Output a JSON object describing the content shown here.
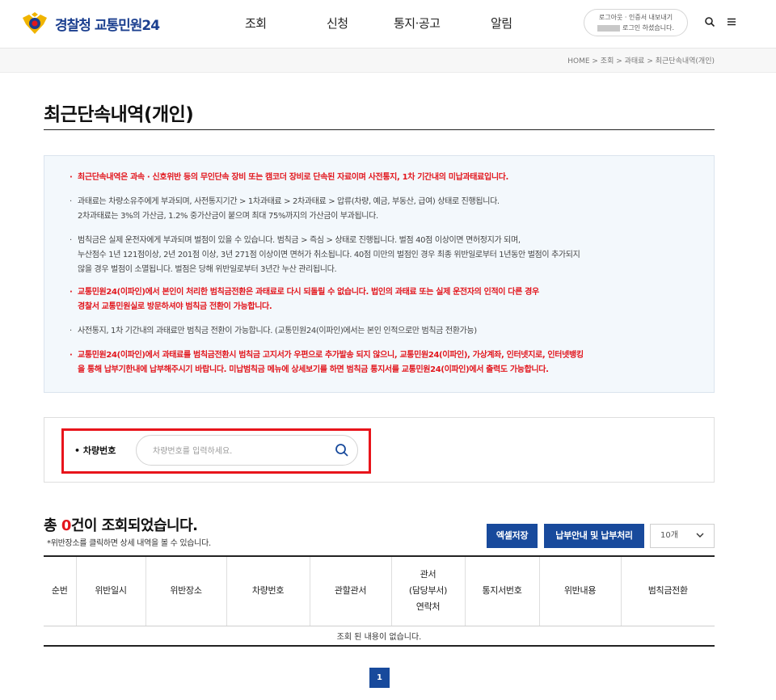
{
  "header": {
    "logo_text": "경찰청 교통민원24",
    "nav": [
      "조회",
      "신청",
      "통지·공고",
      "알림"
    ],
    "login_line1": "로그아웃 · 인증서 내보내기",
    "login_line2": "로그인 하셨습니다."
  },
  "breadcrumb": "HOME > 조회 > 과태료 > 최근단속내역(개인)",
  "page_title": "최근단속내역(개인)",
  "notices": [
    {
      "color": "red",
      "lines": [
        "최근단속내역은 과속 · 신호위반 등의 무인단속 장비 또는 캠코더 장비로 단속된 자료이며 사전통지, 1차 기간내의 미납과태료입니다."
      ]
    },
    {
      "color": "gray",
      "lines": [
        "과태료는 차량소유주에게 부과되며, 사전통지기간 > 1차과태료 > 2차과태료 > 압류(차량, 예금, 부동산, 급여) 상태로 진행됩니다.",
        "2차과태료는 3%의 가산금, 1.2% 중가산금이 붙으며 최대 75%까지의 가산금이 부과됩니다."
      ]
    },
    {
      "color": "gray",
      "lines": [
        "범칙금은 실제 운전자에게 부과되며 벌점이 있을 수 있습니다. 범칙금 > 즉심 > 상태로 진행됩니다. 벌점 40점 이상이면 면허정지가 되며,",
        "누산점수 1년 121점이상, 2년 201점 이상, 3년 271점 이상이면 면허가 취소됩니다. 40점 미만의 벌점인 경우 최종 위반일로부터 1년동안 벌점이 추가되지",
        "않을 경우 벌점이 소멸됩니다. 벌점은 당해 위반일로부터 3년간 누산 관리됩니다."
      ]
    },
    {
      "color": "red",
      "lines": [
        "교통민원24(이파인)에서 본인이 처리한 범칙금전환은 과태료로 다시 되돌릴 수 없습니다. 법인의 과태료 또는 실제 운전자의 인적이 다른 경우",
        "경찰서 교통민원실로 방문하셔야 범칙금 전환이 가능합니다."
      ]
    },
    {
      "color": "gray",
      "lines": [
        "사전통지, 1차 기간내의 과태료만 범칙금 전환이 가능합니다. (교통민원24(이파인)에서는 본인 인적으로만 범칙금 전환가능)"
      ]
    },
    {
      "color": "red",
      "lines": [
        "교통민원24(이파인)에서 과태료를 범칙금전환시 범칙금 고지서가 우편으로 추가발송 되지 않으니, 교통민원24(이파인), 가상계좌, 인터넷지로, 인터넷뱅킹",
        "을 통해 납부기한내에 납부해주시기 바랍니다. 미납범칙금 메뉴에 상세보기를 하면 범칙금 통지서를 교통민원24(이파인)에서 출력도 가능합니다."
      ]
    }
  ],
  "search": {
    "label": "• 차량번호",
    "placeholder": "차량번호를 입력하세요.",
    "value": ""
  },
  "results": {
    "total_prefix": "총 ",
    "count": "0",
    "total_suffix": "건이 조회되었습니다.",
    "hint": "*위반장소를 클릭하면 상세 내역을 볼 수 있습니다.",
    "excel_button": "엑셀저장",
    "pay_button": "납부안내 및 납부처리",
    "page_size": "10개"
  },
  "table": {
    "columns": [
      "순번",
      "위반일시",
      "위반장소",
      "차량번호",
      "관할관서",
      "관서\n(담당부서)\n연락처",
      "통지서번호",
      "위반내용",
      "범칙금전환"
    ],
    "empty_message": "조회 된 내용이 없습니다."
  },
  "pagination": {
    "current": "1"
  },
  "colors": {
    "brand": "#184a9c",
    "alert": "#e2161d",
    "highlight": "#e8141b"
  },
  "icons": [
    "police-emblem-icon",
    "search-icon",
    "menu-icon",
    "chevron-down-icon"
  ]
}
